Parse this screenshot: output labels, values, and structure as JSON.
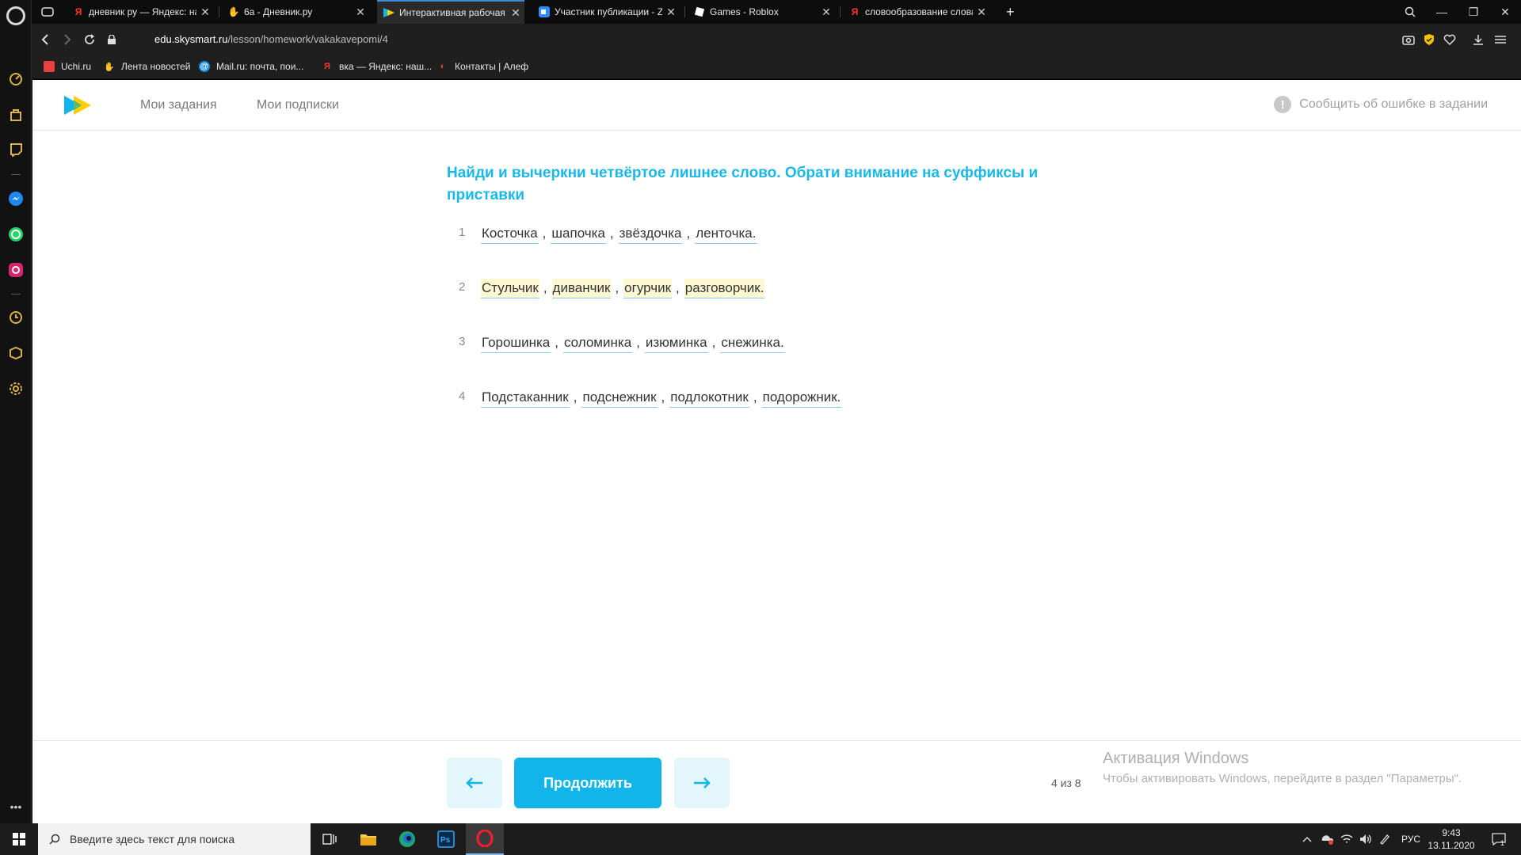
{
  "browser": {
    "tabs": [
      {
        "title": "дневник ру — Яндекс: на",
        "favicon": "yandex-icon"
      },
      {
        "title": "6а - Дневник.ру",
        "favicon": "dnevnik-icon"
      },
      {
        "title": "Интерактивная рабочая т",
        "favicon": "skysmart-icon",
        "active": true
      },
      {
        "title": "Участник публикации - Z",
        "favicon": "zoom-icon"
      },
      {
        "title": "Games - Roblox",
        "favicon": "roblox-icon"
      },
      {
        "title": "словообразование слова",
        "favicon": "yandex-icon"
      }
    ],
    "url_domain": "edu.skysmart.ru",
    "url_path": "/lesson/homework/vakakavepomi/4",
    "bookmarks": [
      {
        "label": "Uchi.ru"
      },
      {
        "label": "Лента новостей"
      },
      {
        "label": "Mail.ru: почта, пои..."
      },
      {
        "label": "вка — Яндекс: наш..."
      },
      {
        "label": "Контакты | Алеф"
      }
    ]
  },
  "site": {
    "nav": {
      "my_tasks": "Мои задания",
      "my_subscriptions": "Мои подписки"
    },
    "report_error": "Сообщить об ошибке в задании",
    "task_title": "Найди и вычеркни четвёртое лишнее слово. Обрати внимание на суффиксы и приставки",
    "rows": [
      {
        "num": "1",
        "words": [
          "Косточка",
          "шапочка",
          "звёздочка",
          "ленточка."
        ],
        "highlighted": false
      },
      {
        "num": "2",
        "words": [
          "Стульчик",
          "диванчик",
          "огурчик",
          "разговорчик."
        ],
        "highlighted": true
      },
      {
        "num": "3",
        "words": [
          "Горошинка",
          "соломинка",
          "изюминка",
          "снежинка."
        ],
        "highlighted": false
      },
      {
        "num": "4",
        "words": [
          "Подстаканник",
          "подснежник",
          "подлокотник",
          "подорожник."
        ],
        "highlighted": false
      }
    ],
    "footer": {
      "continue_label": "Продолжить",
      "progress": "4 из 8",
      "prev_icon": "arrow-left-icon",
      "next_icon": "arrow-right-icon"
    },
    "activation": {
      "title": "Активация Windows",
      "text": "Чтобы активировать Windows, перейдите в раздел \"Параметры\"."
    },
    "colors": {
      "accent": "#12b5ea",
      "highlight": "#fdf8d2",
      "title": "#1ab8e8"
    }
  },
  "taskbar": {
    "search_placeholder": "Введите здесь текст для поиска",
    "lang": "РУС",
    "time": "9:43",
    "date": "13.11.2020",
    "notifications": "1"
  }
}
